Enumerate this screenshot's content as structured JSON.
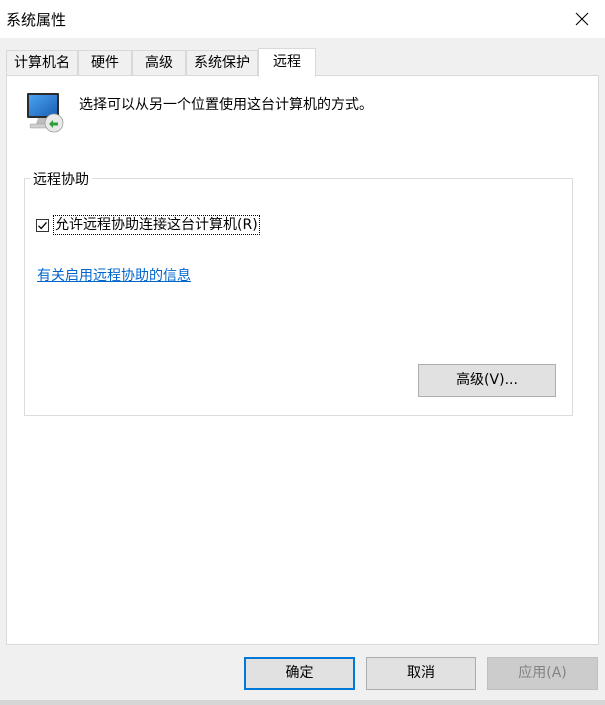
{
  "window": {
    "title": "系统属性",
    "close_icon": "close-icon"
  },
  "tabs": [
    {
      "label": "计算机名",
      "active": false
    },
    {
      "label": "硬件",
      "active": false
    },
    {
      "label": "高级",
      "active": false
    },
    {
      "label": "系统保护",
      "active": false
    },
    {
      "label": "远程",
      "active": true
    }
  ],
  "remote": {
    "icon": "remote-desktop-monitor-icon",
    "intro": "选择可以从另一个位置使用这台计算机的方式。",
    "assistance": {
      "group_title": "远程协助",
      "checkbox_label": "允许远程协助连接这台计算机(R)",
      "checkbox_checked": true,
      "link_text": "有关启用远程协助的信息",
      "advanced_button": "高级(V)..."
    }
  },
  "footer": {
    "ok": "确定",
    "cancel": "取消",
    "apply": "应用(A)",
    "apply_enabled": false
  },
  "colors": {
    "accent": "#0078d7",
    "link": "#0066cc",
    "panel_bg": "#ffffff",
    "window_bg": "#f0f0f0"
  }
}
